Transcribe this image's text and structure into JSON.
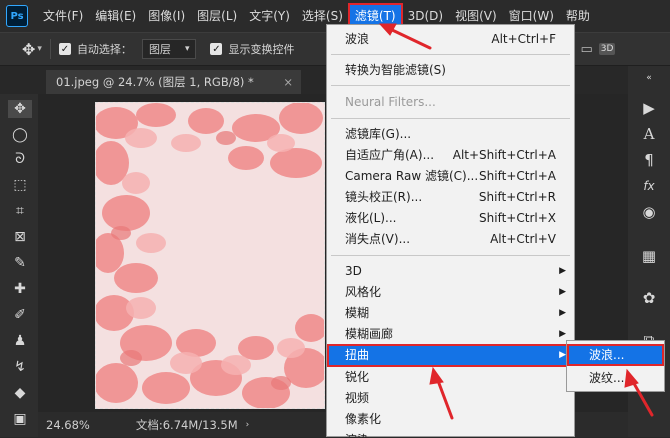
{
  "menubar": {
    "logo": "Ps",
    "items": [
      "文件(F)",
      "编辑(E)",
      "图像(I)",
      "图层(L)",
      "文字(Y)",
      "选择(S)",
      "滤镜(T)",
      "3D(D)",
      "视图(V)",
      "窗口(W)",
      "帮助"
    ]
  },
  "options": {
    "auto_select_label": "自动选择：",
    "auto_select_value": "图层",
    "show_transform_label": "显示变换控件",
    "mode_3d": "3D"
  },
  "document": {
    "tab_title": "01.jpeg @ 24.7% (图层 1, RGB/8) *",
    "close_glyph": "×"
  },
  "status": {
    "zoom": "24.68%",
    "doc_info": "文档:6.74M/13.5M"
  },
  "filter_menu": {
    "wave_last": {
      "label": "波浪",
      "shortcut": "Alt+Ctrl+F"
    },
    "smart": {
      "label": "转换为智能滤镜(S)"
    },
    "neural": {
      "label": "Neural Filters..."
    },
    "group2": [
      {
        "label": "滤镜库(G)...",
        "shortcut": ""
      },
      {
        "label": "自适应广角(A)...",
        "shortcut": "Alt+Shift+Ctrl+A"
      },
      {
        "label": "Camera Raw 滤镜(C)...",
        "shortcut": "Shift+Ctrl+A"
      },
      {
        "label": "镜头校正(R)...",
        "shortcut": "Shift+Ctrl+R"
      },
      {
        "label": "液化(L)...",
        "shortcut": "Shift+Ctrl+X"
      },
      {
        "label": "消失点(V)...",
        "shortcut": "Alt+Ctrl+V"
      }
    ],
    "group3": [
      {
        "label": "3D",
        "submenu": "▶"
      },
      {
        "label": "风格化",
        "submenu": "▶"
      },
      {
        "label": "模糊",
        "submenu": "▶"
      },
      {
        "label": "模糊画廊",
        "submenu": "▶"
      },
      {
        "label": "扭曲",
        "submenu": "▶"
      },
      {
        "label": "锐化",
        "submenu": ""
      },
      {
        "label": "视频",
        "submenu": ""
      },
      {
        "label": "像素化",
        "submenu": ""
      },
      {
        "label": "渲染",
        "submenu": ""
      }
    ]
  },
  "distort_submenu": {
    "items": [
      "波浪...",
      "波纹..."
    ]
  },
  "colors": {
    "highlight": "#1473e6",
    "annotation_red": "#e0262b"
  }
}
